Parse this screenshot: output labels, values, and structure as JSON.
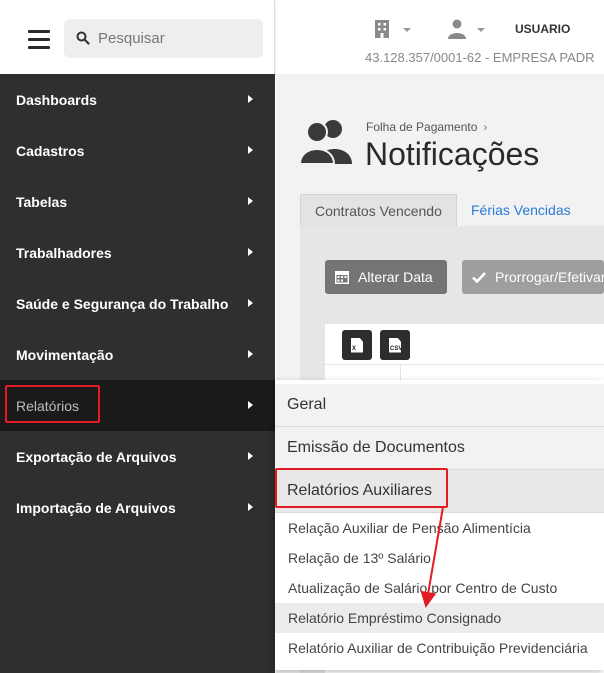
{
  "search": {
    "placeholder": "Pesquisar"
  },
  "sidebar": {
    "items": [
      {
        "label": "Dashboards"
      },
      {
        "label": "Cadastros"
      },
      {
        "label": "Tabelas"
      },
      {
        "label": "Trabalhadores"
      },
      {
        "label": "Saúde e Segurança do Trabalho"
      },
      {
        "label": "Movimentação"
      },
      {
        "label": "Relatórios"
      },
      {
        "label": "Exportação de Arquivos"
      },
      {
        "label": "Importação de Arquivos"
      }
    ]
  },
  "header": {
    "user": "USUARIO",
    "company": "43.128.357/0001-62 - EMPRESA PADR"
  },
  "main": {
    "breadcrumb": "Folha de Pagamento",
    "breadcrumb_sep": "›",
    "title": "Notificações",
    "tabs": [
      {
        "label": "Contratos Vencendo"
      },
      {
        "label": "Férias Vencidas"
      }
    ],
    "buttons": {
      "alterar": "Alterar Data",
      "prorrogar": "Prorrogar/Efetivar"
    },
    "export": {
      "xls": "X",
      "csv": "CSV"
    }
  },
  "flyout": {
    "headers": [
      {
        "label": "Geral"
      },
      {
        "label": "Emissão de Documentos"
      },
      {
        "label": "Relatórios Auxiliares"
      }
    ],
    "items": [
      {
        "label": "Relação Auxiliar de Pensão Alimentícia"
      },
      {
        "label": "Relação de 13º Salário"
      },
      {
        "label": "Atualização de Salário por Centro de Custo"
      },
      {
        "label": "Relatório Empréstimo Consignado"
      },
      {
        "label": "Relatório Auxiliar de Contribuição Previdenciária"
      }
    ]
  },
  "colors": {
    "sidebar_bg": "#2f2f2f",
    "active_bg": "#1a1a1a",
    "highlight_red": "#e31b23",
    "link_blue": "#2a7ad6"
  }
}
